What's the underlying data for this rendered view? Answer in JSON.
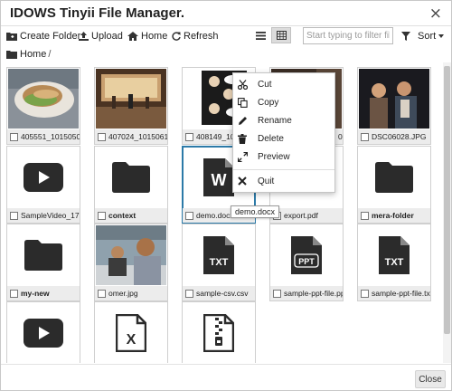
{
  "dialog": {
    "title": "IDOWS Tinyii File Manager.",
    "close_symbol": "×"
  },
  "toolbar": {
    "create_folder": "Create Folder",
    "upload": "Upload",
    "home": "Home",
    "refresh": "Refresh",
    "filter_placeholder": "Start typing to filter files.",
    "sort": "Sort"
  },
  "breadcrumb": {
    "root": "Home",
    "separator": "/"
  },
  "files": [
    {
      "name": "405551_101505007",
      "kind": "photo-sandwich"
    },
    {
      "name": "407024_101506179",
      "kind": "photo-stage"
    },
    {
      "name": "408149_101",
      "kind": "photo-comic"
    },
    {
      "name": "07",
      "kind": "photo-dark"
    },
    {
      "name": "DSC06028.JPG",
      "kind": "photo-people"
    },
    {
      "name": "SampleVideo_176x1",
      "kind": "video-icon"
    },
    {
      "name": "context",
      "kind": "folder-icon"
    },
    {
      "name": "demo.docx",
      "kind": "word-icon"
    },
    {
      "name": "export.pdf",
      "kind": "blank"
    },
    {
      "name": "mera-folder",
      "kind": "folder-icon"
    },
    {
      "name": "my-new",
      "kind": "folder-icon"
    },
    {
      "name": "omer.jpg",
      "kind": "photo-cafe"
    },
    {
      "name": "sample-csv.csv",
      "kind": "txt-icon"
    },
    {
      "name": "sample-ppt-file.ppt",
      "kind": "ppt-icon"
    },
    {
      "name": "sample-ppt-file.txt",
      "kind": "txt-icon"
    },
    {
      "name": "",
      "kind": "video-icon"
    },
    {
      "name": "",
      "kind": "excel-icon"
    },
    {
      "name": "",
      "kind": "zip-icon"
    }
  ],
  "file_icon_labels": {
    "word": "W",
    "txt": "TXT",
    "ppt": "PPT",
    "excel": "X"
  },
  "context_menu": {
    "cut": "Cut",
    "copy": "Copy",
    "rename": "Rename",
    "delete": "Delete",
    "preview": "Preview",
    "quit": "Quit"
  },
  "tooltip": "demo.docx",
  "footer": {
    "close": "Close"
  },
  "colors": {
    "selected_border": "#2c7aa8",
    "caption_bg": "#ececec",
    "icon_dark": "#2b2b2b"
  }
}
